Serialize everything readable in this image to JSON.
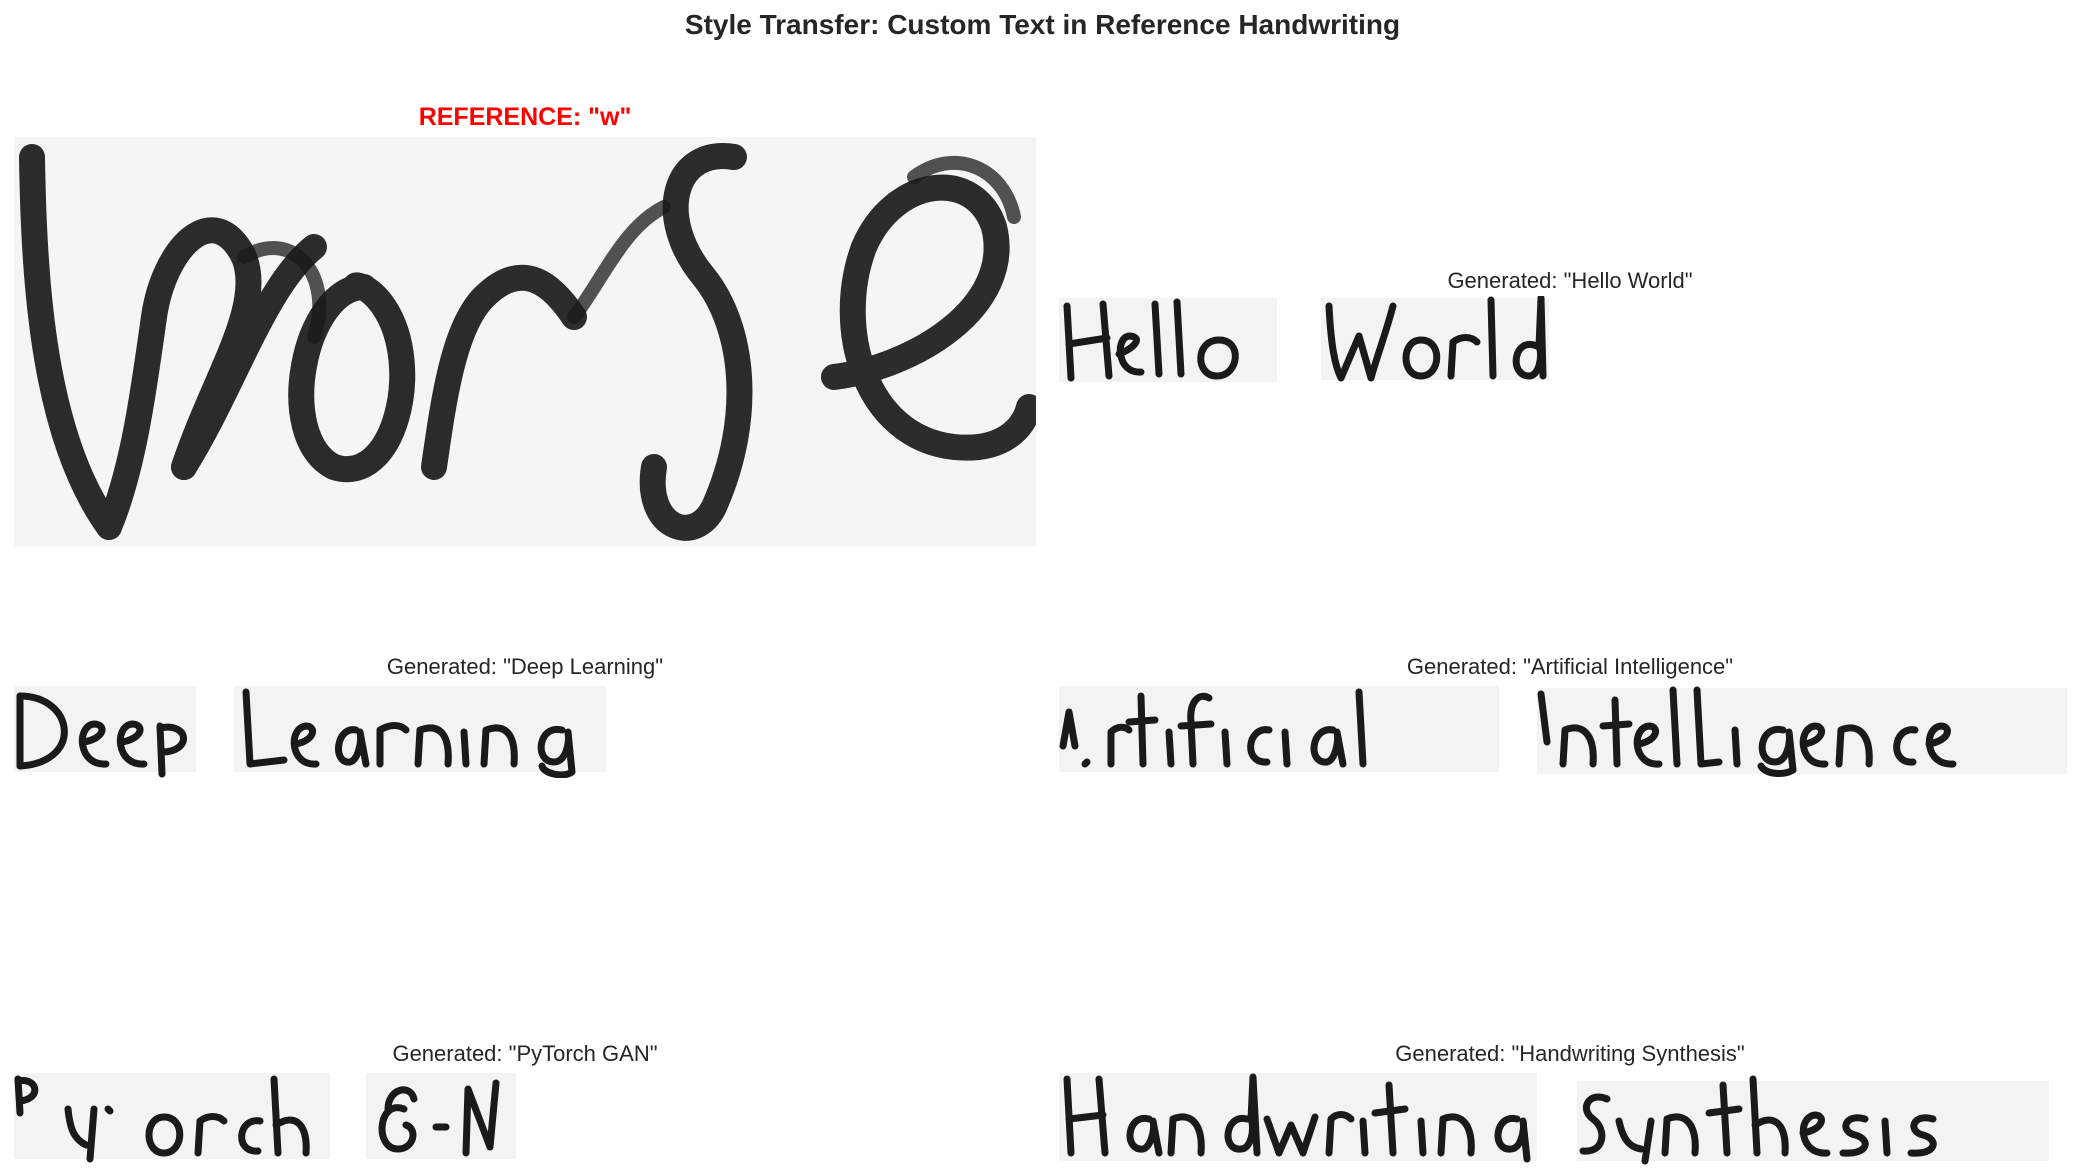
{
  "figure": {
    "title": "Style Transfer: Custom Text in Reference Handwriting"
  },
  "reference": {
    "title": "REFERENCE: \"w\"",
    "title_color": "#ff0000",
    "image_word": "worse"
  },
  "generated": [
    {
      "title": "Generated: \"Hello World\"",
      "text": "Hello World"
    },
    {
      "title": "Generated: \"Deep Learning\"",
      "text": "Deep Learning"
    },
    {
      "title": "Generated: \"Artificial Intelligence\"",
      "text": "Artificial Intelligence"
    },
    {
      "title": "Generated: \"PyTorch GAN\"",
      "text": "PyTorch GAN"
    },
    {
      "title": "Generated: \"Handwriting Synthesis\"",
      "text": "Handwriting Synthesis"
    }
  ]
}
